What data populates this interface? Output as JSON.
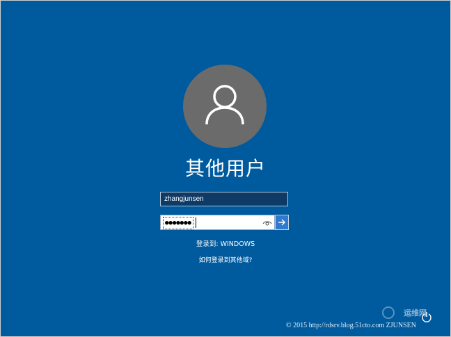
{
  "login": {
    "user_title": "其他用户",
    "username_value": "zhangjunsen",
    "password_mask": "●●●●●●●",
    "domain_text": "登录到: WINDOWS",
    "other_domain_link": "如何登录到其他域?"
  },
  "overlay": {
    "watermark": "运维网",
    "copyright": "© 2015 http://rdsrv.blog.51cto.com ZJUNSEN"
  },
  "colors": {
    "background": "#005a9e",
    "avatar": "#6b6b6b",
    "username_field": "#0e3a66",
    "submit_button": "#2f7ad0"
  },
  "icons": [
    "user-icon",
    "eye-icon",
    "arrow-right-icon",
    "power-icon"
  ]
}
